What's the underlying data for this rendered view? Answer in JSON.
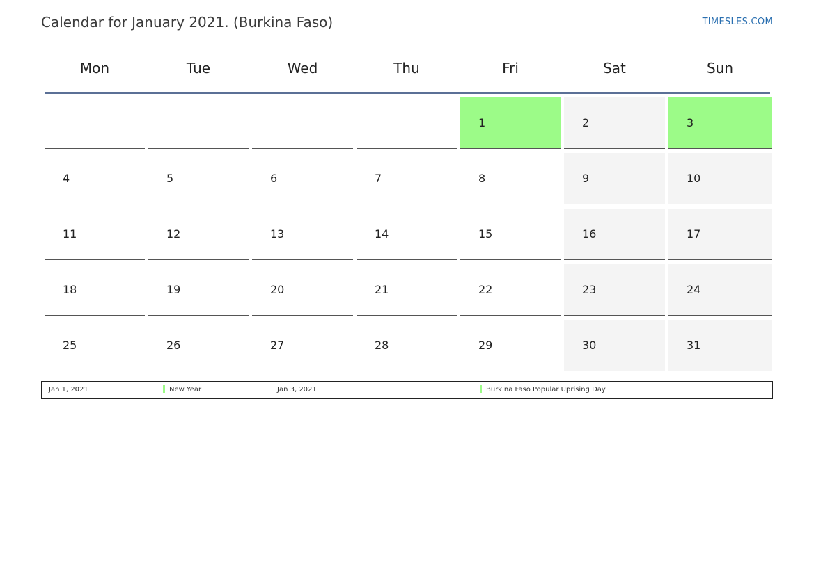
{
  "header": {
    "title": "Calendar for January 2021. (Burkina Faso)",
    "brand": "TIMESLES.COM"
  },
  "colors": {
    "holiday": "#9cfb88",
    "weekend": "#f4f4f4",
    "header_rule": "#5b7096",
    "brand": "#2a6fb0"
  },
  "weekdays": [
    "Mon",
    "Tue",
    "Wed",
    "Thu",
    "Fri",
    "Sat",
    "Sun"
  ],
  "weeks": [
    [
      {
        "day": "",
        "type": "empty"
      },
      {
        "day": "",
        "type": "empty"
      },
      {
        "day": "",
        "type": "empty"
      },
      {
        "day": "",
        "type": "empty"
      },
      {
        "day": "1",
        "type": "holiday"
      },
      {
        "day": "2",
        "type": "weekend"
      },
      {
        "day": "3",
        "type": "holiday"
      }
    ],
    [
      {
        "day": "4",
        "type": "normal"
      },
      {
        "day": "5",
        "type": "normal"
      },
      {
        "day": "6",
        "type": "normal"
      },
      {
        "day": "7",
        "type": "normal"
      },
      {
        "day": "8",
        "type": "normal"
      },
      {
        "day": "9",
        "type": "weekend"
      },
      {
        "day": "10",
        "type": "weekend"
      }
    ],
    [
      {
        "day": "11",
        "type": "normal"
      },
      {
        "day": "12",
        "type": "normal"
      },
      {
        "day": "13",
        "type": "normal"
      },
      {
        "day": "14",
        "type": "normal"
      },
      {
        "day": "15",
        "type": "normal"
      },
      {
        "day": "16",
        "type": "weekend"
      },
      {
        "day": "17",
        "type": "weekend"
      }
    ],
    [
      {
        "day": "18",
        "type": "normal"
      },
      {
        "day": "19",
        "type": "normal"
      },
      {
        "day": "20",
        "type": "normal"
      },
      {
        "day": "21",
        "type": "normal"
      },
      {
        "day": "22",
        "type": "normal"
      },
      {
        "day": "23",
        "type": "weekend"
      },
      {
        "day": "24",
        "type": "weekend"
      }
    ],
    [
      {
        "day": "25",
        "type": "normal"
      },
      {
        "day": "26",
        "type": "normal"
      },
      {
        "day": "27",
        "type": "normal"
      },
      {
        "day": "28",
        "type": "normal"
      },
      {
        "day": "29",
        "type": "normal"
      },
      {
        "day": "30",
        "type": "weekend"
      },
      {
        "day": "31",
        "type": "weekend"
      }
    ]
  ],
  "legend": {
    "holidays": [
      {
        "date": "Jan 1, 2021",
        "name": "New Year"
      },
      {
        "date": "Jan 3, 2021",
        "name": "Burkina Faso Popular Uprising Day"
      }
    ]
  }
}
